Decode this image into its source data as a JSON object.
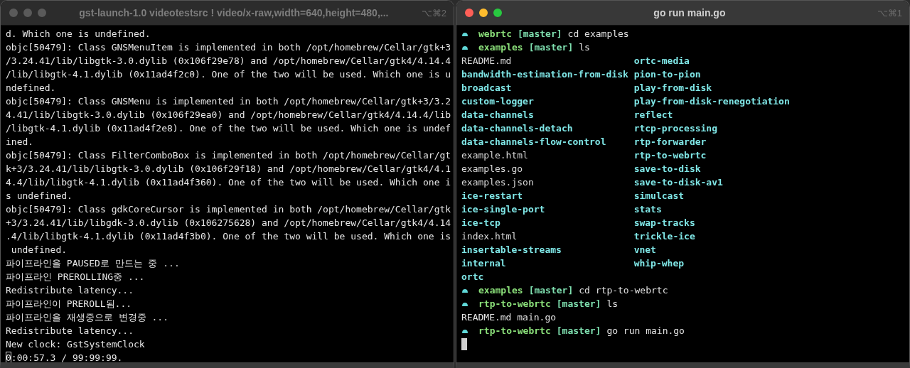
{
  "windows": [
    {
      "title": "gst-launch-1.0 videotestsrc ! video/x-raw,width=640,height=480,...",
      "shortcut": "⌥⌘2",
      "active": false,
      "lines": [
        {
          "kind": "text",
          "text": "d. Which one is undefined."
        },
        {
          "kind": "text",
          "text": "objc[50479]: Class GNSMenuItem is implemented in both /opt/homebrew/Cellar/gtk+3"
        },
        {
          "kind": "text",
          "text": "/3.24.41/lib/libgtk-3.0.dylib (0x106f29e78) and /opt/homebrew/Cellar/gtk4/4.14.4"
        },
        {
          "kind": "text",
          "text": "/lib/libgtk-4.1.dylib (0x11ad4f2c0). One of the two will be used. Which one is u"
        },
        {
          "kind": "text",
          "text": "ndefined."
        },
        {
          "kind": "text",
          "text": "objc[50479]: Class GNSMenu is implemented in both /opt/homebrew/Cellar/gtk+3/3.2"
        },
        {
          "kind": "text",
          "text": "4.41/lib/libgtk-3.0.dylib (0x106f29ea0) and /opt/homebrew/Cellar/gtk4/4.14.4/lib"
        },
        {
          "kind": "text",
          "text": "/libgtk-4.1.dylib (0x11ad4f2e8). One of the two will be used. Which one is undef"
        },
        {
          "kind": "text",
          "text": "ined."
        },
        {
          "kind": "text",
          "text": "objc[50479]: Class FilterComboBox is implemented in both /opt/homebrew/Cellar/gt"
        },
        {
          "kind": "text",
          "text": "k+3/3.24.41/lib/libgtk-3.0.dylib (0x106f29f18) and /opt/homebrew/Cellar/gtk4/4.1"
        },
        {
          "kind": "text",
          "text": "4.4/lib/libgtk-4.1.dylib (0x11ad4f360). One of the two will be used. Which one i"
        },
        {
          "kind": "text",
          "text": "s undefined."
        },
        {
          "kind": "text",
          "text": "objc[50479]: Class gdkCoreCursor is implemented in both /opt/homebrew/Cellar/gtk"
        },
        {
          "kind": "text",
          "text": "+3/3.24.41/lib/libgdk-3.0.dylib (0x106275628) and /opt/homebrew/Cellar/gtk4/4.14"
        },
        {
          "kind": "text",
          "text": ".4/lib/libgtk-4.1.dylib (0x11ad4f3b0). One of the two will be used. Which one is"
        },
        {
          "kind": "text",
          "text": " undefined."
        },
        {
          "kind": "text",
          "text": "파이프라인을 PAUSED로 만드는 중 ..."
        },
        {
          "kind": "text",
          "text": "파이프라인 PREROLLING중 ..."
        },
        {
          "kind": "text",
          "text": "Redistribute latency..."
        },
        {
          "kind": "text",
          "text": "파이프라인이 PREROLL됨..."
        },
        {
          "kind": "text",
          "text": "파이프라인을 재생중으로 변경중 ..."
        },
        {
          "kind": "text",
          "text": "Redistribute latency..."
        },
        {
          "kind": "text",
          "text": "New clock: GstSystemClock"
        },
        {
          "kind": "cursor_text",
          "cursor": "0",
          "text": ":00:57.3 / 99:99:99."
        }
      ]
    },
    {
      "title": "go run main.go",
      "shortcut": "⌥⌘1",
      "active": true,
      "lines": [
        {
          "kind": "prompt",
          "dir": "webrtc",
          "branch": "[master]",
          "command": "cd examples"
        },
        {
          "kind": "prompt",
          "dir": "examples",
          "branch": "[master]",
          "command": "ls"
        },
        {
          "kind": "listing",
          "entries": [
            {
              "name": "README.md",
              "kind": "file"
            },
            {
              "name": "ortc-media",
              "kind": "dir"
            },
            {
              "name": "bandwidth-estimation-from-disk",
              "kind": "dir"
            },
            {
              "name": "pion-to-pion",
              "kind": "dir"
            },
            {
              "name": "broadcast",
              "kind": "dir"
            },
            {
              "name": "play-from-disk",
              "kind": "dir"
            },
            {
              "name": "custom-logger",
              "kind": "dir"
            },
            {
              "name": "play-from-disk-renegotiation",
              "kind": "dir"
            },
            {
              "name": "data-channels",
              "kind": "dir"
            },
            {
              "name": "reflect",
              "kind": "dir"
            },
            {
              "name": "data-channels-detach",
              "kind": "dir"
            },
            {
              "name": "rtcp-processing",
              "kind": "dir"
            },
            {
              "name": "data-channels-flow-control",
              "kind": "dir"
            },
            {
              "name": "rtp-forwarder",
              "kind": "dir"
            },
            {
              "name": "example.html",
              "kind": "file"
            },
            {
              "name": "rtp-to-webrtc",
              "kind": "dir"
            },
            {
              "name": "examples.go",
              "kind": "file"
            },
            {
              "name": "save-to-disk",
              "kind": "dir"
            },
            {
              "name": "examples.json",
              "kind": "file"
            },
            {
              "name": "save-to-disk-av1",
              "kind": "dir"
            },
            {
              "name": "ice-restart",
              "kind": "dir"
            },
            {
              "name": "simulcast",
              "kind": "dir"
            },
            {
              "name": "ice-single-port",
              "kind": "dir"
            },
            {
              "name": "stats",
              "kind": "dir"
            },
            {
              "name": "ice-tcp",
              "kind": "dir"
            },
            {
              "name": "swap-tracks",
              "kind": "dir"
            },
            {
              "name": "index.html",
              "kind": "file"
            },
            {
              "name": "trickle-ice",
              "kind": "dir"
            },
            {
              "name": "insertable-streams",
              "kind": "dir"
            },
            {
              "name": "vnet",
              "kind": "dir"
            },
            {
              "name": "internal",
              "kind": "dir"
            },
            {
              "name": "whip-whep",
              "kind": "dir"
            },
            {
              "name": "ortc",
              "kind": "dir"
            }
          ]
        },
        {
          "kind": "prompt",
          "dir": "examples",
          "branch": "[master]",
          "command": "cd rtp-to-webrtc"
        },
        {
          "kind": "prompt",
          "dir": "rtp-to-webrtc",
          "branch": "[master]",
          "command": "ls"
        },
        {
          "kind": "text",
          "text": "README.md main.go"
        },
        {
          "kind": "prompt",
          "dir": "rtp-to-webrtc",
          "branch": "[master]",
          "command": "go run main.go"
        },
        {
          "kind": "cursor"
        }
      ]
    }
  ]
}
